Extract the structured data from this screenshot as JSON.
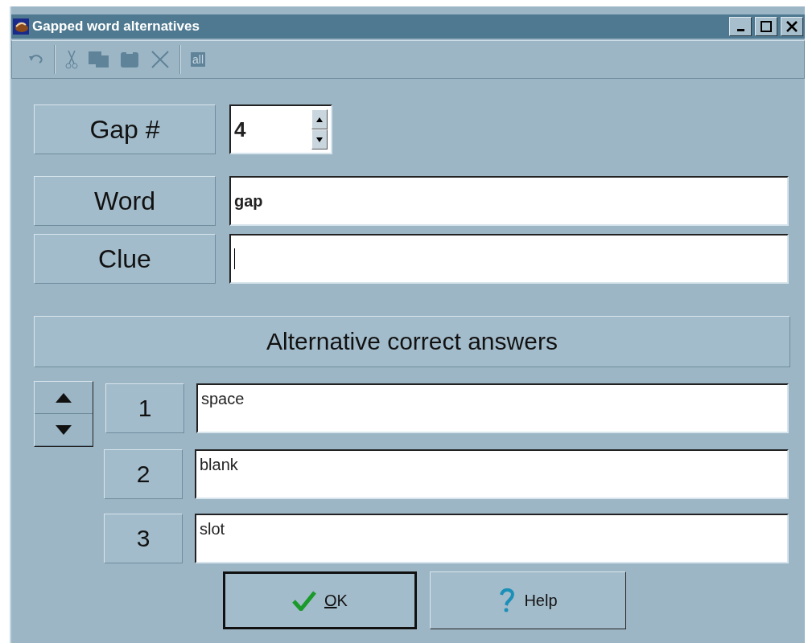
{
  "window": {
    "title": "Gapped word alternatives"
  },
  "toolbar": [
    {
      "kind": "undo",
      "disabled": true
    },
    {
      "kind": "separator"
    },
    {
      "kind": "cut",
      "disabled": true
    },
    {
      "kind": "copy",
      "disabled": true
    },
    {
      "kind": "paste",
      "disabled": true
    },
    {
      "kind": "delete",
      "disabled": true
    },
    {
      "kind": "separator"
    },
    {
      "kind": "select_all",
      "label": "all",
      "disabled": true
    }
  ],
  "gap": {
    "label": "Gap #",
    "value": "4"
  },
  "word": {
    "label": "Word",
    "value": "gap"
  },
  "clue": {
    "label": "Clue",
    "focused": true
  },
  "alternatives": {
    "heading": "Alternative correct answers",
    "rows": [
      {
        "number": "1",
        "value": "space"
      },
      {
        "number": "2",
        "value": "blank"
      },
      {
        "number": "3",
        "value": "slot"
      }
    ]
  },
  "buttons": [
    {
      "kind": "ok",
      "label": "OK",
      "underline_first": true,
      "default": true
    },
    {
      "kind": "help",
      "label": "Help",
      "underline_first": false,
      "default": false
    }
  ]
}
